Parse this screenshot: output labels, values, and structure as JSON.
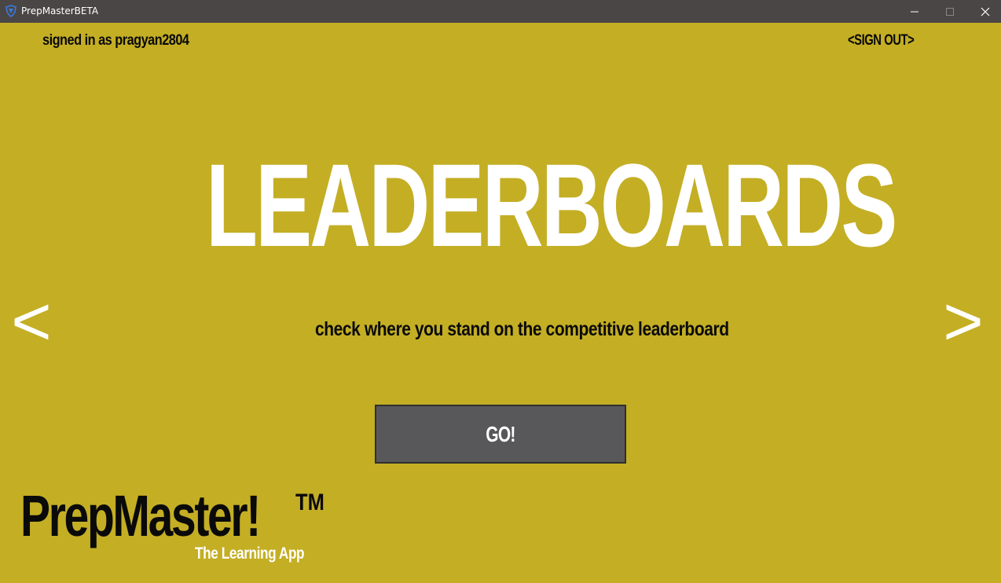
{
  "window": {
    "title": "PrepMasterBETA",
    "controls": {
      "minimize": "minimize-icon",
      "maximize": "maximize-icon",
      "close": "close-icon"
    }
  },
  "header": {
    "signed_in": "signed in as pragyan2804",
    "sign_out": "<SIGN OUT>"
  },
  "main": {
    "title": "LEADERBOARDS",
    "description": "check where you stand on the competitive leaderboard",
    "go_label": "GO!",
    "prev_label": "<",
    "next_label": ">"
  },
  "logo": {
    "name": "PrepMaster!",
    "trademark": "TM",
    "tagline": "The Learning App"
  },
  "colors": {
    "background": "#c4ae24",
    "titlebar": "#4a4646",
    "button": "#58585b",
    "headline": "#ffffff",
    "text": "#0a0a0a"
  }
}
